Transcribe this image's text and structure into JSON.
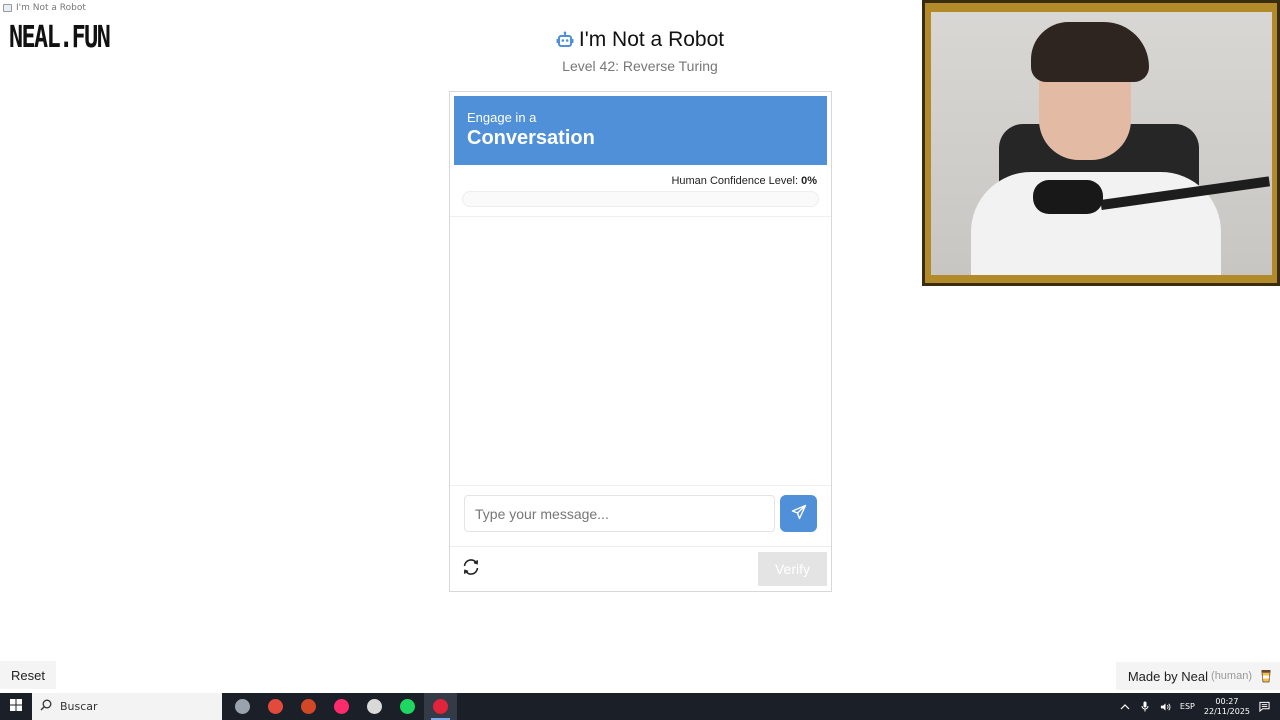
{
  "window": {
    "title": "I'm Not a Robot"
  },
  "logo": {
    "text": "NEAL.FUN"
  },
  "header": {
    "title": "I'm Not a Robot",
    "subtitle": "Level 42: Reverse Turing"
  },
  "card": {
    "header_small": "Engage in a",
    "header_big": "Conversation",
    "confidence_label": "Human Confidence Level:",
    "confidence_value": "0%",
    "confidence_fraction": 0,
    "input_placeholder": "Type your message...",
    "verify_label": "Verify"
  },
  "footer": {
    "reset_label": "Reset",
    "made_by": "Made by Neal",
    "human_tag": "(human)"
  },
  "taskbar": {
    "search_label": "Buscar",
    "apps": [
      {
        "icon": "shield-icon",
        "color": "#9aa3ad"
      },
      {
        "icon": "chrome-icon",
        "color": "#e24a3b"
      },
      {
        "icon": "powerpoint-icon",
        "color": "#d24726"
      },
      {
        "icon": "tiktok-icon",
        "color": "#ff2b6a"
      },
      {
        "icon": "pinwheel-icon",
        "color": "#d9d9d9"
      },
      {
        "icon": "spotify-icon",
        "color": "#1ed760"
      },
      {
        "icon": "opera-icon",
        "color": "#e0243b"
      }
    ],
    "lang": "ESP",
    "time": "00:27",
    "date": "22/11/2025"
  },
  "colors": {
    "accent": "#4f90d9",
    "taskbar": "#1b1f27"
  }
}
